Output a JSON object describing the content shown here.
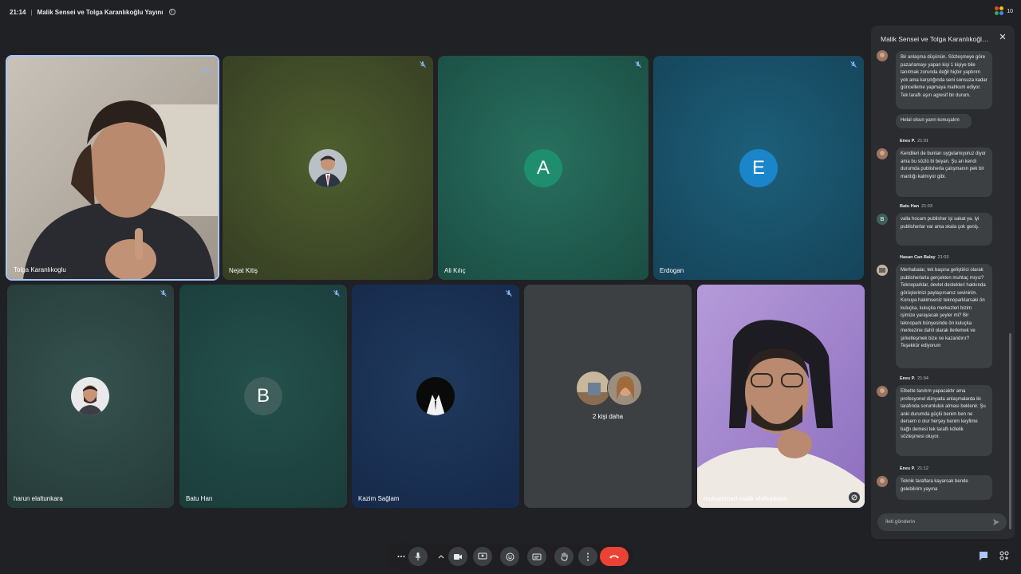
{
  "header": {
    "time": "21:14",
    "separator": "|",
    "meeting_title": "Malik Sensei ve Tolga Karanlıkoğlu Yayını",
    "participant_count": "10"
  },
  "tiles": [
    {
      "name": "Tolga Karanlıkoglu",
      "type": "video"
    },
    {
      "name": "Nejat Kitiş",
      "type": "avatar-photo"
    },
    {
      "name": "Ali Kılıç",
      "type": "letter",
      "letter": "A",
      "color": "#1e8e6e"
    },
    {
      "name": "Erdogan",
      "type": "letter",
      "letter": "E",
      "color": "#1a85c9"
    },
    {
      "name": "harun elaltunkara",
      "type": "avatar-photo"
    },
    {
      "name": "Batu Han",
      "type": "letter",
      "letter": "B",
      "color": "#3e5f5b"
    },
    {
      "name": "Kazim Sağlam",
      "type": "avatar-photo"
    },
    {
      "name": "2 kişi daha",
      "type": "more"
    },
    {
      "name": "muhammed malik elaltunkara",
      "type": "video"
    }
  ],
  "chat": {
    "title": "Malik Sensei ve Tolga Karanlıkoğlu Yayını",
    "messages": [
      {
        "text": "Bir anlaşma düşünün. Sözleşmeye göre pazarlamayı yapan kişi 1 kişiye bile tanıtmak zorunda değil hiçbir yaptırım yok ama karşılığında seni sonsuza kadar güncelleme yapmaya mahkum ediyor. Tek taraflı aşırı agresif bir durum."
      },
      {
        "text": "Helal olsun yarın konuşalım"
      },
      {
        "sender": "Enes P.",
        "time": "21:01",
        "text": "Kendileri de bunları uygulamıyoruz diyor ama bu sözlü bi beyan. Şu an kendi durumda publisherla çalışmanın pek bir mantığı kalmıyor gibi."
      },
      {
        "sender": "Batu Han",
        "time": "21:03",
        "avatar_letter": "B",
        "text": "valla hocam publisher işi sakat ya. iyi publisherlar var ama skala çok geniş."
      },
      {
        "sender": "Hasan Can Balay",
        "time": "21:03",
        "text": "Merhabalar, tek başına geliştirici olarak publisherlarla gerçekten muhtaç mıyız? Teknoparklar, devlet destekleri hakkında görüşlerinizi paylaşırsanız sevinirim. Konuya hakimseniz teknoparklarsaki ön kuluçka, kuluçka merkezleri bizim işimize yarayacak şeyler mi? Bir teknopark bünyesinde ön kuluçka merkezine dahil olarak ilerlemek ve şirketleşmek bize ne kazandırır? Teşekkür ediyorum"
      },
      {
        "sender": "Enes P.",
        "time": "21:04",
        "text": "Elbette tanıtım yapacaktır ama profesyonel dünyada anlaşmalarda iki tarafında sorumluluk alması beklenir. Şu anki durumda güçlü benim ben ne dersem o olur herşey benim keyfime bağlı demesi tek taraflı kölelik sözleşmesi oluyor."
      },
      {
        "sender": "Enes P.",
        "time": "21:12",
        "text": "Teknik taraflara kayarsak bende gelebilirim yayına"
      }
    ],
    "input_placeholder": "İleti gönderin"
  },
  "toolbar": {
    "buttons": [
      "more-options",
      "microphone",
      "camera-options",
      "camera",
      "present",
      "reactions",
      "captions",
      "raise-hand",
      "more",
      "leave-call"
    ]
  },
  "colors": {
    "background": "#202124",
    "end_call": "#ea4335",
    "active_speaker_border": "#a8c7fa"
  }
}
